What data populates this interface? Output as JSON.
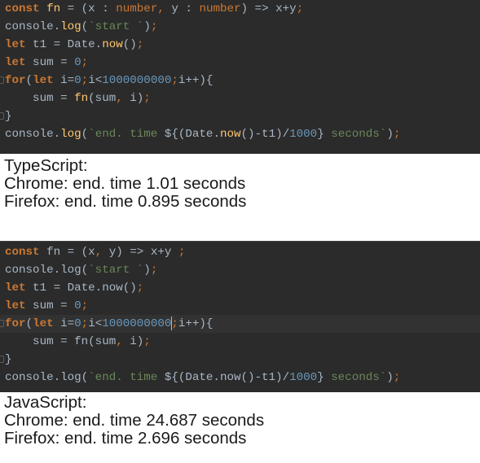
{
  "typescript_editor": {
    "lines": [
      [
        {
          "t": "const",
          "c": "kw"
        },
        {
          "t": " fn",
          "c": "fn"
        },
        {
          "t": " = (x : ",
          "c": "tx"
        },
        {
          "t": "number",
          "c": "ty"
        },
        {
          "t": ",",
          "c": "pun"
        },
        {
          "t": " y : ",
          "c": "tx"
        },
        {
          "t": "number",
          "c": "ty"
        },
        {
          "t": ") => x+y",
          "c": "tx"
        },
        {
          "t": ";",
          "c": "pun"
        }
      ],
      [
        {
          "t": "console.",
          "c": "tx"
        },
        {
          "t": "log",
          "c": "fn"
        },
        {
          "t": "(",
          "c": "tx"
        },
        {
          "t": "`start `",
          "c": "str"
        },
        {
          "t": ")",
          "c": "tx"
        },
        {
          "t": ";",
          "c": "pun"
        }
      ],
      [
        {
          "t": "let",
          "c": "kw"
        },
        {
          "t": " t1 = Date.",
          "c": "tx"
        },
        {
          "t": "now",
          "c": "fn"
        },
        {
          "t": "()",
          "c": "tx"
        },
        {
          "t": ";",
          "c": "pun"
        }
      ],
      [
        {
          "t": "let",
          "c": "kw"
        },
        {
          "t": " sum = ",
          "c": "tx"
        },
        {
          "t": "0",
          "c": "num"
        },
        {
          "t": ";",
          "c": "pun"
        }
      ],
      [
        {
          "t": "for",
          "c": "kw"
        },
        {
          "t": "(",
          "c": "tx"
        },
        {
          "t": "let",
          "c": "kw"
        },
        {
          "t": " i=",
          "c": "tx"
        },
        {
          "t": "0",
          "c": "num"
        },
        {
          "t": ";",
          "c": "pun"
        },
        {
          "t": "i<",
          "c": "tx"
        },
        {
          "t": "1000000000",
          "c": "num"
        },
        {
          "t": ";",
          "c": "pun"
        },
        {
          "t": "i++){",
          "c": "tx"
        }
      ],
      [
        {
          "t": "    sum = ",
          "c": "tx"
        },
        {
          "t": "fn",
          "c": "fn"
        },
        {
          "t": "(sum",
          "c": "tx"
        },
        {
          "t": ",",
          "c": "pun"
        },
        {
          "t": " i)",
          "c": "tx"
        },
        {
          "t": ";",
          "c": "pun"
        }
      ],
      [
        {
          "t": "}",
          "c": "tx"
        }
      ],
      [
        {
          "t": "console.",
          "c": "tx"
        },
        {
          "t": "log",
          "c": "fn"
        },
        {
          "t": "(",
          "c": "tx"
        },
        {
          "t": "`end. time ",
          "c": "str"
        },
        {
          "t": "${(Date.",
          "c": "tx"
        },
        {
          "t": "now",
          "c": "fn"
        },
        {
          "t": "()-t1)/",
          "c": "tx"
        },
        {
          "t": "1000",
          "c": "num"
        },
        {
          "t": "}",
          "c": "tx"
        },
        {
          "t": " seconds`",
          "c": "str"
        },
        {
          "t": ")",
          "c": "tx"
        },
        {
          "t": ";",
          "c": "pun"
        }
      ]
    ]
  },
  "typescript_results": {
    "heading": "TypeScript:",
    "chrome": "Chrome: end. time 1.01 seconds",
    "firefox": "Firefox: end. time 0.895 seconds"
  },
  "javascript_editor": {
    "current_line": 4,
    "lines": [
      [
        {
          "t": "const",
          "c": "kw"
        },
        {
          "t": " fn = (x",
          "c": "tx"
        },
        {
          "t": ",",
          "c": "pun"
        },
        {
          "t": " y) => x+y ",
          "c": "tx"
        },
        {
          "t": ";",
          "c": "pun"
        }
      ],
      [
        {
          "t": "console.log(",
          "c": "tx"
        },
        {
          "t": "`start `",
          "c": "str"
        },
        {
          "t": ")",
          "c": "tx"
        },
        {
          "t": ";",
          "c": "pun"
        }
      ],
      [
        {
          "t": "let",
          "c": "kw"
        },
        {
          "t": " t1 = Date.now()",
          "c": "tx"
        },
        {
          "t": ";",
          "c": "pun"
        }
      ],
      [
        {
          "t": "let",
          "c": "kw"
        },
        {
          "t": " sum = ",
          "c": "tx"
        },
        {
          "t": "0",
          "c": "num"
        },
        {
          "t": ";",
          "c": "pun"
        }
      ],
      [
        {
          "t": "for",
          "c": "kw"
        },
        {
          "t": "(",
          "c": "tx"
        },
        {
          "t": "let",
          "c": "kw"
        },
        {
          "t": " i=",
          "c": "tx"
        },
        {
          "t": "0",
          "c": "num"
        },
        {
          "t": ";",
          "c": "pun"
        },
        {
          "t": "i<",
          "c": "tx"
        },
        {
          "t": "1000000000",
          "c": "num"
        },
        {
          "t": "|caret|",
          "c": "caret"
        },
        {
          "t": ";",
          "c": "pun"
        },
        {
          "t": "i++){",
          "c": "tx"
        }
      ],
      [
        {
          "t": "    sum = fn(sum",
          "c": "tx"
        },
        {
          "t": ",",
          "c": "pun"
        },
        {
          "t": " i)",
          "c": "tx"
        },
        {
          "t": ";",
          "c": "pun"
        }
      ],
      [
        {
          "t": "}",
          "c": "tx"
        }
      ],
      [
        {
          "t": "console.log(",
          "c": "tx"
        },
        {
          "t": "`end. time ",
          "c": "str"
        },
        {
          "t": "${(Date.now()-t1)/",
          "c": "tx"
        },
        {
          "t": "1000",
          "c": "num"
        },
        {
          "t": "}",
          "c": "tx"
        },
        {
          "t": " seconds`",
          "c": "str"
        },
        {
          "t": ")",
          "c": "tx"
        },
        {
          "t": ";",
          "c": "pun"
        }
      ]
    ]
  },
  "javascript_results": {
    "heading": "JavaScript:",
    "chrome": "Chrome: end. time 24.687 seconds",
    "firefox": "Firefox: end. time 2.696 seconds"
  },
  "colors": {
    "editor_bg": "#2b2b2b",
    "keyword": "#cc7832",
    "function": "#ffc66d",
    "string": "#6a8759",
    "number": "#6897bb",
    "text": "#a9b7c6"
  }
}
